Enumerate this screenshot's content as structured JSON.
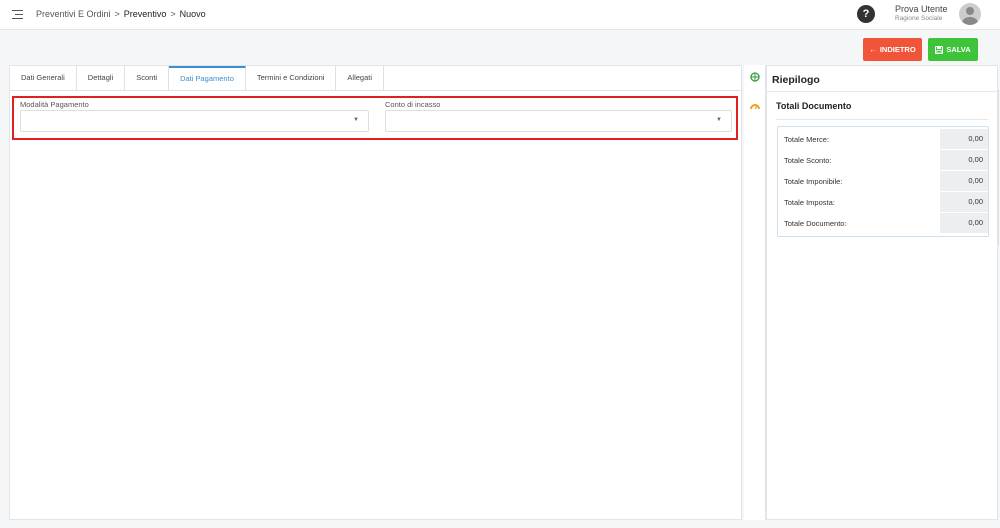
{
  "breadcrumb": {
    "section": "Preventivi E Ordini",
    "sep1": ">",
    "page": "Preventivo",
    "sep2": ">",
    "current": "Nuovo"
  },
  "user": {
    "name": "Prova Utente",
    "role": "Ragione Sociale",
    "help": "?"
  },
  "actions": {
    "back_label": "INDIETRO",
    "back_icon": "←",
    "save_label": "SALVA",
    "save_icon": "floppy-disk-icon"
  },
  "tabs": [
    {
      "label": "Dati Generali"
    },
    {
      "label": "Dettagli"
    },
    {
      "label": "Sconti"
    },
    {
      "label": "Dati Pagamento"
    },
    {
      "label": "Termini e Condizioni"
    },
    {
      "label": "Allegati"
    }
  ],
  "active_tab": "Dati Pagamento",
  "form": {
    "payment_method_label": "Modalità Pagamento",
    "payment_method_value": "",
    "collection_account_label": "Conto di incasso",
    "collection_account_value": ""
  },
  "summary": {
    "title": "Riepilogo",
    "section_title": "Totali Documento",
    "rows": [
      {
        "label": "Totale Merce:",
        "value": "0,00"
      },
      {
        "label": "Totale Sconto:",
        "value": "0,00"
      },
      {
        "label": "Totale Imponibile:",
        "value": "0,00"
      },
      {
        "label": "Totale Imposta:",
        "value": "0,00"
      },
      {
        "label": "Totale Documento:",
        "value": "0,00"
      }
    ]
  },
  "colors": {
    "accent": "#3b8fd0",
    "back_button": "#f0553a",
    "save_button": "#3ec33a",
    "highlight": "#e02020"
  }
}
